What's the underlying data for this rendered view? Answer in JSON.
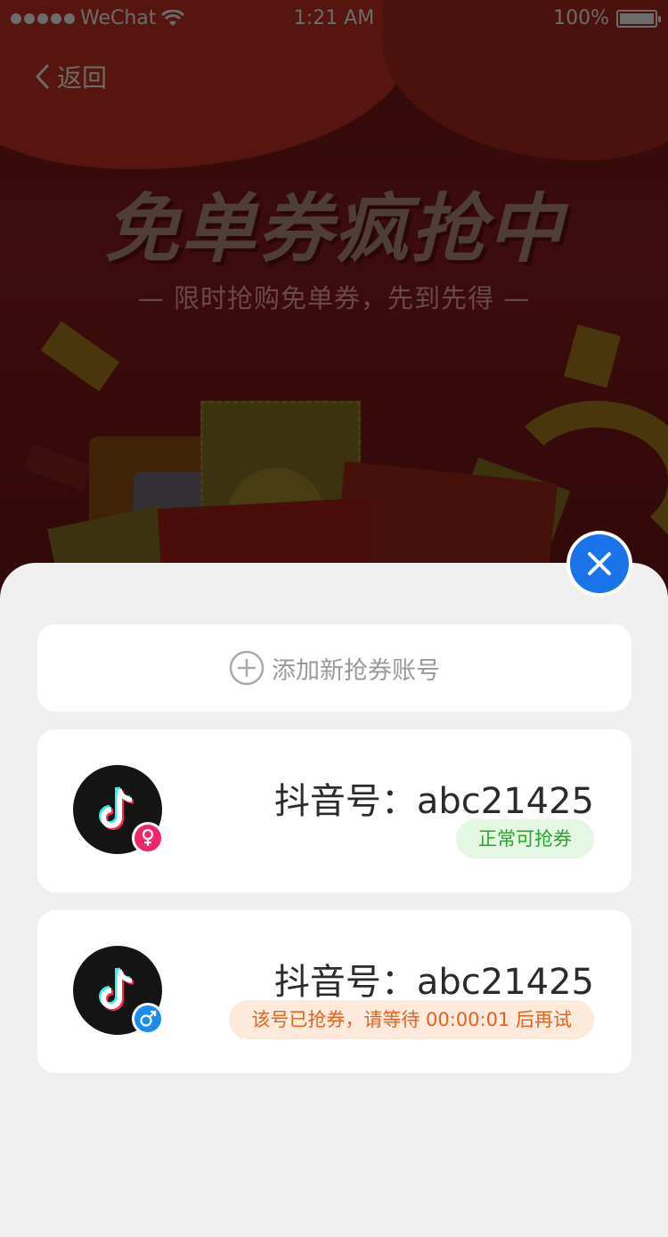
{
  "status_bar": {
    "carrier": "WeChat",
    "time": "1:21 AM",
    "battery": "100%",
    "battery_level": 1.0
  },
  "nav": {
    "back_label": "返回"
  },
  "banner": {
    "headline": "免单券疯抢中",
    "subline": "— 限时抢购免单券，先到先得 —"
  },
  "sheet": {
    "add_account_label": "添加新抢券账号",
    "accounts": [
      {
        "name": "抖音号：abc21425",
        "gender": "female",
        "status": "正常可抢券",
        "status_type": "ok"
      },
      {
        "name": "抖音号：abc21425",
        "gender": "male",
        "status": "该号已抢券，请等待 00:00:01 后再试",
        "status_type": "wait"
      }
    ]
  },
  "colors": {
    "accent_blue": "#1a73e8",
    "ok_green": "#2aa52d",
    "wait_orange": "#e8621d",
    "female_pink": "#f2256b",
    "male_blue": "#1a8cf0"
  }
}
